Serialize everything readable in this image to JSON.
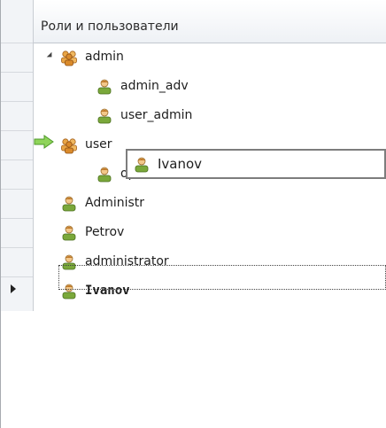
{
  "header": {
    "title": "Роли и пользователи"
  },
  "tree": {
    "nodes": [
      {
        "label": "admin",
        "type": "group",
        "expanded": true
      },
      {
        "label": "admin_adv",
        "type": "user"
      },
      {
        "label": "user_admin",
        "type": "user"
      },
      {
        "label": "user",
        "type": "group",
        "drop_target": true
      },
      {
        "label": "operator",
        "type": "user"
      },
      {
        "label": "Administr",
        "type": "user"
      },
      {
        "label": "Petrov",
        "type": "user"
      },
      {
        "label": "administrator",
        "type": "user"
      },
      {
        "label": "Ivanov",
        "type": "user",
        "selected": true
      }
    ]
  },
  "drag": {
    "label": "Ivanov",
    "icon": "user-icon"
  },
  "colors": {
    "group_icon": "#d98a2b",
    "user_icon": "#7aa83a",
    "drop_arrow": "#6bbf3a"
  }
}
